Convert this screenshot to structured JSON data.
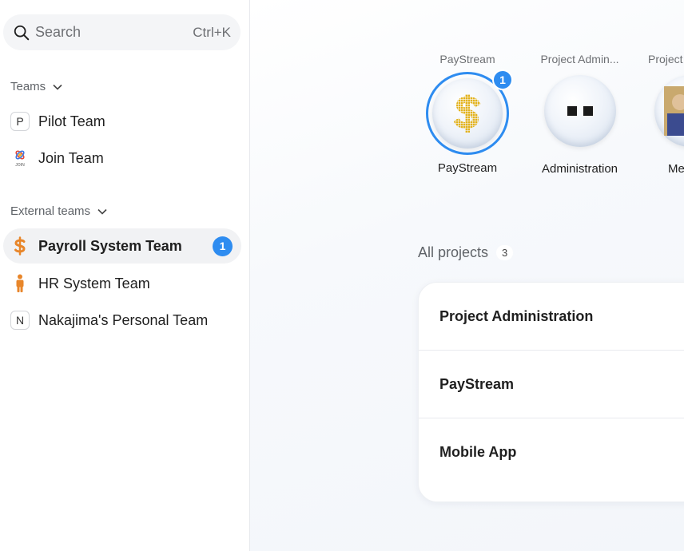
{
  "search": {
    "placeholder": "Search",
    "shortcut": "Ctrl+K"
  },
  "sidebar": {
    "teams_title": "Teams",
    "teams": [
      {
        "label": "Pilot Team",
        "icon_letter": "P"
      },
      {
        "label": "Join Team",
        "icon": "join-logo-icon",
        "logo_text": "JOIN"
      }
    ],
    "external_title": "External teams",
    "external": [
      {
        "label": "Payroll System Team",
        "icon": "dollar-icon",
        "badge": "1",
        "active": true
      },
      {
        "label": "HR System Team",
        "icon": "person-icon"
      },
      {
        "label": "Nakajima's Personal Team",
        "icon_letter": "N"
      }
    ]
  },
  "bubbles": [
    {
      "top_label": "PayStream",
      "bottom_label": "PayStream",
      "badge": "1",
      "icon": "dollar-pixel-icon"
    },
    {
      "top_label": "Project Admin...",
      "bottom_label": "Administration",
      "icon": "two-squares-icon"
    },
    {
      "top_label": "Project",
      "bottom_label": "Me",
      "icon": "portrait-icon"
    }
  ],
  "projects": {
    "title": "All projects",
    "count": "3",
    "rows": [
      "Project Administration",
      "PayStream",
      "Mobile App"
    ]
  },
  "colors": {
    "accent": "#2e8cf0",
    "dollar": "#e8862a",
    "dollar_pixel": "#e3b21c"
  }
}
